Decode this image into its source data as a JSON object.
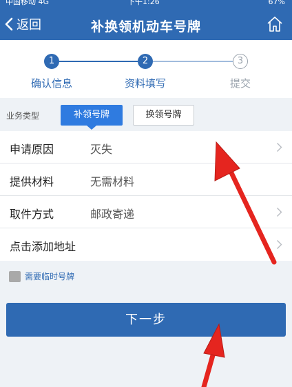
{
  "status_bar": {
    "carrier": "中国移动  4G",
    "time": "下午1:26",
    "battery": "67%"
  },
  "nav": {
    "back_label": "返回",
    "title": "补换领机动车号牌"
  },
  "steps": [
    {
      "number": "1",
      "label": "确认信息",
      "state": "active"
    },
    {
      "number": "2",
      "label": "资料填写",
      "state": "active"
    },
    {
      "number": "3",
      "label": "提交",
      "state": "inactive"
    }
  ],
  "business": {
    "label": "业务类型",
    "options": [
      "补领号牌",
      "换领号牌"
    ],
    "selected": "补领号牌"
  },
  "form": {
    "rows": [
      {
        "label": "申请原因",
        "value": "灭失",
        "chevron": true
      },
      {
        "label": "提供材料",
        "value": "无需材料",
        "chevron": false
      },
      {
        "label": "取件方式",
        "value": "邮政寄递",
        "chevron": true
      },
      {
        "label": "点击添加地址",
        "value": "",
        "chevron": true
      }
    ]
  },
  "temp_plate": {
    "label": "需要临时号牌",
    "checked": false
  },
  "next_button": {
    "label": "下一步"
  },
  "colors": {
    "primary": "#2f6ab3",
    "tab_selected": "#2f7be0",
    "annotation_arrow": "#e5251f"
  },
  "icons": {
    "back": "chevron-left-icon",
    "home": "home-icon",
    "row": "chevron-right-icon"
  }
}
